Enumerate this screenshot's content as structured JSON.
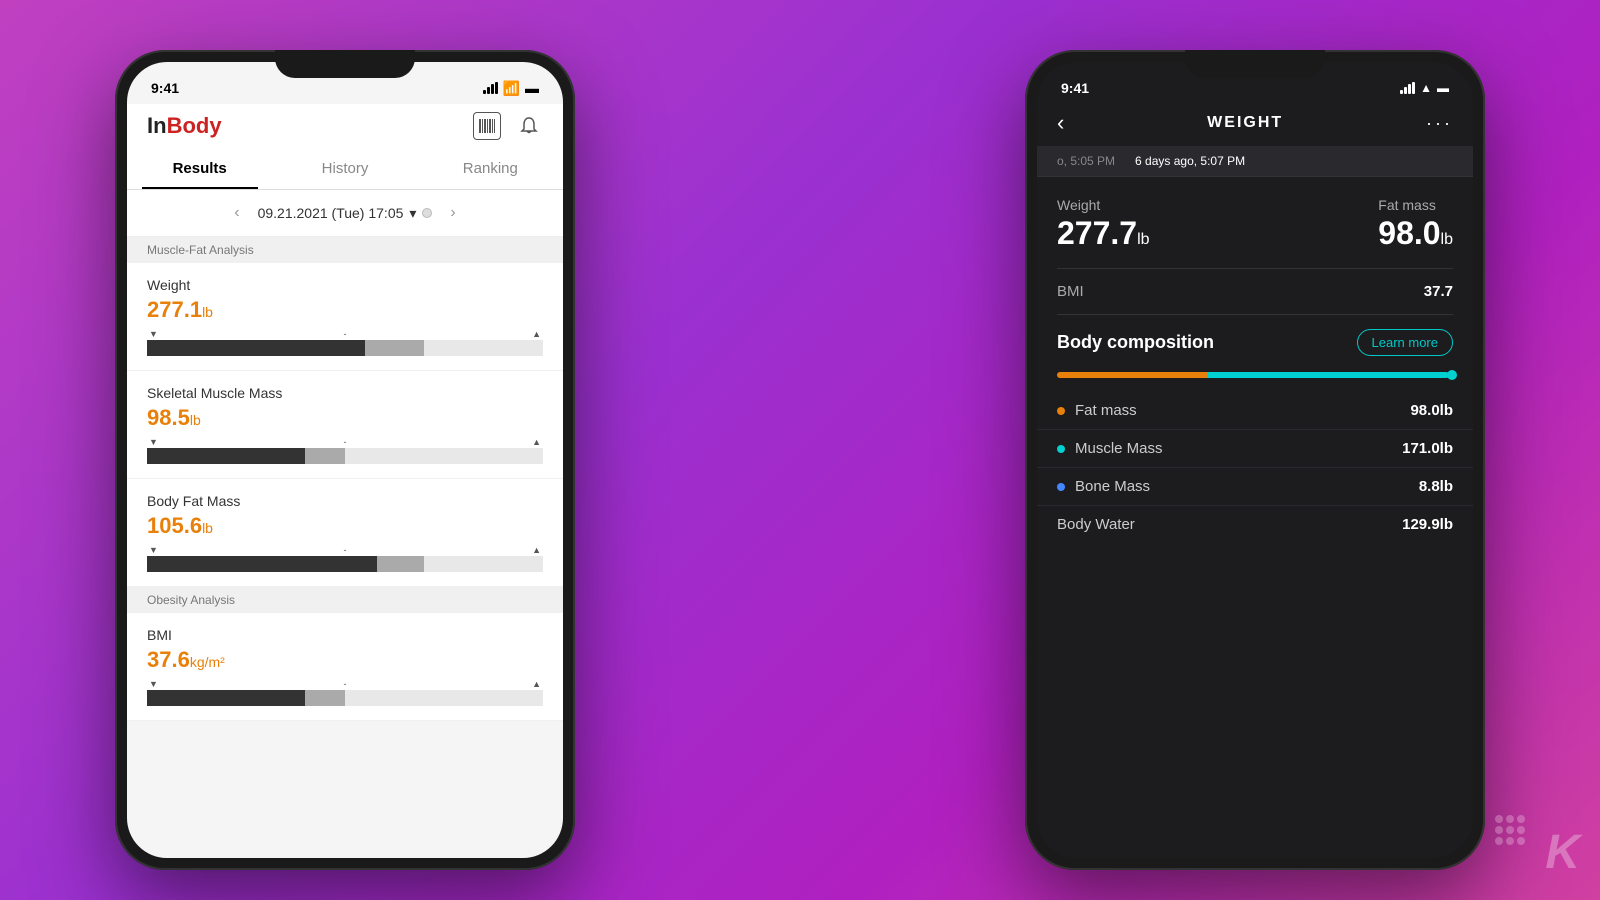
{
  "background": {
    "gradient": "linear-gradient(135deg, #c040c0 0%, #9b30d0 40%, #b020c0 70%, #d040a0 100%)"
  },
  "watermark": {
    "letter": "K"
  },
  "phone_left": {
    "status_bar": {
      "time": "9:41",
      "signal": "signal-bars-icon",
      "wifi": "wifi-icon",
      "battery": "battery-icon"
    },
    "header": {
      "logo_in": "In",
      "logo_body": "Body",
      "barcode_icon": "barcode-icon",
      "bell_icon": "bell-icon"
    },
    "tabs": [
      {
        "label": "Results",
        "active": true
      },
      {
        "label": "History",
        "active": false
      },
      {
        "label": "Ranking",
        "active": false
      }
    ],
    "date_nav": {
      "prev_arrow": "‹",
      "date": "09.21.2021 (Tue) 17:05",
      "dropdown_icon": "▾",
      "next_arrow": "›"
    },
    "sections": [
      {
        "label": "Muscle-Fat Analysis",
        "metrics": [
          {
            "name": "Weight",
            "value": "277.1",
            "unit": "lb",
            "bar_dark_pct": 55,
            "bar_gray_pct": 15
          },
          {
            "name": "Skeletal Muscle Mass",
            "value": "98.5",
            "unit": "lb",
            "bar_dark_pct": 40,
            "bar_gray_pct": 10
          },
          {
            "name": "Body Fat Mass",
            "value": "105.6",
            "unit": "lb",
            "bar_dark_pct": 58,
            "bar_gray_pct": 12
          }
        ]
      },
      {
        "label": "Obesity Analysis",
        "metrics": [
          {
            "name": "BMI",
            "value": "37.6",
            "unit": "kg/m²",
            "bar_dark_pct": 40,
            "bar_gray_pct": 10
          }
        ]
      }
    ]
  },
  "phone_right": {
    "status_bar": {
      "time": "9:41",
      "signal": "signal-bars-icon",
      "wifi": "wifi-icon",
      "battery": "battery-icon"
    },
    "nav": {
      "back_label": "‹",
      "title": "WEIGHT",
      "more_label": "···"
    },
    "timeline": [
      {
        "label": "5:05 PM",
        "prefix": "o,",
        "active": false
      },
      {
        "label": "6 days ago, 5:07 PM",
        "active": true
      }
    ],
    "primary_metrics": {
      "weight_label": "Weight",
      "weight_value": "277.7",
      "weight_unit": "lb",
      "fat_mass_label": "Fat mass",
      "fat_mass_value": "98.0",
      "fat_mass_unit": "lb"
    },
    "bmi": {
      "label": "BMI",
      "value": "37.7"
    },
    "body_composition": {
      "title": "Body composition",
      "learn_more": "Learn more",
      "progress_orange_pct": 38,
      "progress_cyan_pct": 61,
      "items": [
        {
          "label": "Fat mass",
          "value": "98.0lb",
          "dot": "orange"
        },
        {
          "label": "Muscle Mass",
          "value": "171.0lb",
          "dot": "cyan"
        },
        {
          "label": "Bone Mass",
          "value": "8.8lb",
          "dot": "blue"
        }
      ],
      "body_water_label": "Body Water",
      "body_water_value": "129.9lb"
    }
  }
}
